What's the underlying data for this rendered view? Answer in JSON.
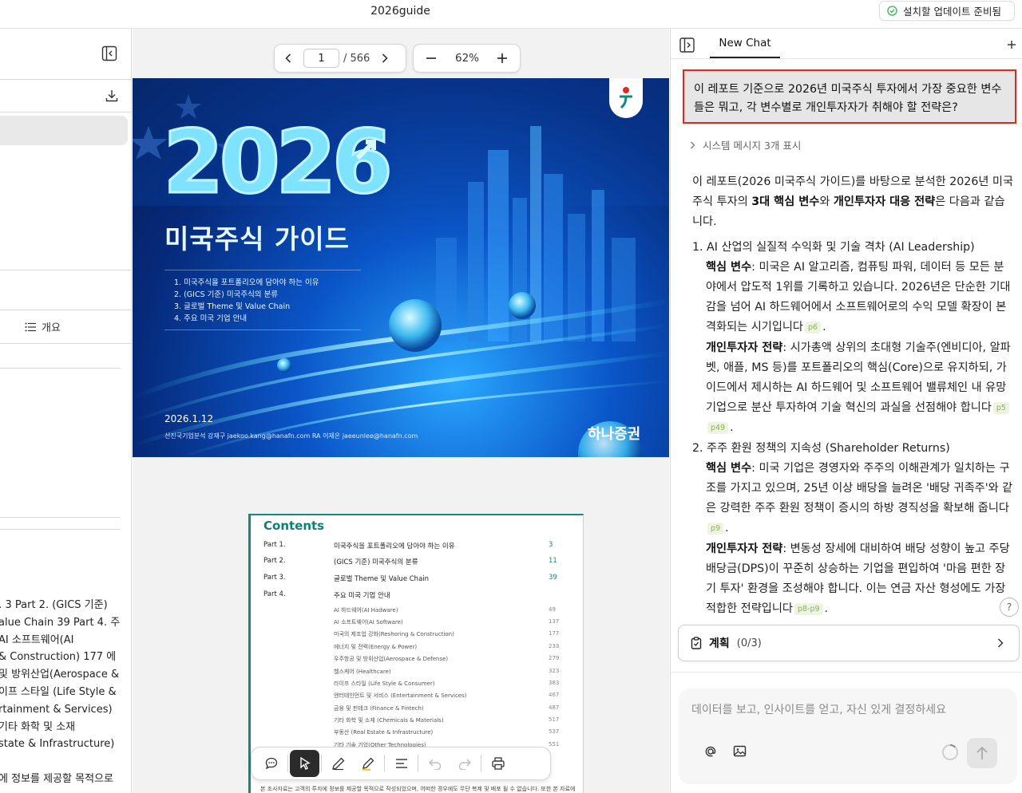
{
  "window": {
    "title": "2026guide",
    "update_status": "설치할 업데이트 준비됨"
  },
  "left_panel": {
    "outline_label": "개요",
    "text_lines": [
      "․ 3 Part 2. (GICS 기준)",
      "alue Chain 39 Part 4. 주",
      "AI 소프트웨어(AI",
      "& Construction) 177 에",
      "및 방위산업(Aerospace &",
      "이프 스타일 (Life Style &",
      "rtainment & Services)",
      "기타 화학 및 소재",
      "state & Infrastructure)",
      "",
      "에 정보를 제공할 목적으로"
    ]
  },
  "viewer": {
    "current_page": "1",
    "total_pages": "/ 566",
    "zoom": "62%",
    "cover": {
      "year": "2026",
      "title": "미국주식 가이드",
      "toc": [
        "1. 미국주식을 포트폴리오에 담아야 하는 이유",
        "2. (GICS 기준) 미국주식의 분류",
        "3. 글로벌 Theme 및 Value Chain",
        "4. 주요 미국 기업 안내"
      ],
      "date": "2026.1.12",
      "authors": "선진국기업분석 강재구 jaekoo.kang@hanafn.com        RA 이재은 jaeeunlee@hanafn.com",
      "brand": "하나증권"
    },
    "contents": {
      "title": "Contents",
      "parts": [
        {
          "label": "Part 1.",
          "title": "미국주식을 포트폴리오에 담아야 하는 이유",
          "page": "3"
        },
        {
          "label": "Part 2.",
          "title": "(GICS 기준) 미국주식의 분류",
          "page": "11"
        },
        {
          "label": "Part 3.",
          "title": "글로벌 Theme 및 Value Chain",
          "page": "39"
        },
        {
          "label": "Part 4.",
          "title": "주요 미국 기업 안내",
          "page": ""
        }
      ],
      "sub": [
        {
          "title": "AI 하드웨어(AI Hadware)",
          "page": "49"
        },
        {
          "title": "AI 소프트웨어(AI Software)",
          "page": "137"
        },
        {
          "title": "미국의 제조업 강화(Reshoring & Construction)",
          "page": "177"
        },
        {
          "title": "에너지 및 전력(Energy & Power)",
          "page": "233"
        },
        {
          "title": "우주항공 및 방위산업(Aerospace & Defense)",
          "page": "279"
        },
        {
          "title": "헬스케어 (Healthcare)",
          "page": "323"
        },
        {
          "title": "라이프 스타일 (Life Style & Consumer)",
          "page": "383"
        },
        {
          "title": "엔터테인먼트 및 서비스 (Entertainment & Services)",
          "page": "467"
        },
        {
          "title": "금융 및 핀테크 (Finance & Fintech)",
          "page": "487"
        },
        {
          "title": "기타 화학 및 소재 (Chemicals & Materials)",
          "page": "517"
        },
        {
          "title": "부동산 (Real Estate & Infrastructure)",
          "page": "537"
        },
        {
          "title": "기타 기술 기업(Other Technologies)",
          "page": "551"
        }
      ],
      "footer": "본 조사자료는 고객의 투자에 정보를 제공할 목적으로 작성되었으며, 어떠한 경우에도 무단 복제 및 배포 될 수 없습니다. 또한 본 자료에"
    }
  },
  "chat": {
    "tab": "New Chat",
    "user_question": "이 레포트 기준으로 2026년 미국주식 투자에서 가장 중요한 변수들은 뭐고, 각 변수별로 개인투자자가 취해야 할 전략은?",
    "system_toggle": "시스템 메시지 3개 표시",
    "intro_a": "이 레포트(2026 미국주식 가이드)를 바탕으로 분석한 2026년 미국 주식 투자의 ",
    "intro_b1": "3대 핵심 변수",
    "intro_c": "와 ",
    "intro_b2": "개인투자자 대응 전략",
    "intro_d": "은 다음과 같습니다.",
    "item1_title": "1. AI 산업의 실질적 수익화 및 기술 격차 (AI Leadership)",
    "key_label": "핵심 변수",
    "strategy_label": "개인투자자 전략",
    "item1_key": ": 미국은 AI 알고리즘, 컴퓨팅 파워, 데이터 등 모든 분야에서 압도적 1위를 기록하고 있습니다. 2026년은 단순한 기대감을 넘어 AI 하드웨어에서 소프트웨어로의 수익 모델 확장이 본격화되는 시기입니다",
    "item1_key_cite": "p6",
    "item1_strategy": ": 시가총액 상위의 초대형 기술주(엔비디아, 알파벳, 애플, MS 등)를 포트폴리오의 핵심(Core)으로 유지하되, 가이드에서 제시하는 AI 하드웨어 및 소프트웨어 밸류체인 내 유망 기업으로 분산 투자하여 기술 혁신의 과실을 선점해야 합니다",
    "item1_strategy_cites": [
      "p5",
      "p49"
    ],
    "item2_title": "2. 주주 환원 정책의 지속성 (Shareholder Returns)",
    "item2_key": ": 미국 기업은 경영자와 주주의 이해관계가 일치하는 구조를 가지고 있으며, 25년 이상 배당을 늘려온 '배당 귀족주'와 같은 강력한 주주 환원 정책이 증시의 하방 경직성을 확보해 줍니다",
    "item2_key_cite": "p9",
    "item2_strategy": ": 변동성 장세에 대비하여 배당 성향이 높고 주당 배당금(DPS)이 꾸준히 상승하는 기업을 편입하여 '마음 편한 장기 투자' 환경을 조성해야 합니다. 이는 연금 자산 형성에도 가장 적합한 전략입니다",
    "item2_strategy_cite": "p8-p9",
    "plan_label": "계획",
    "plan_count": "(0/3)",
    "input_placeholder": "데이터를 보고, 인사이트를 얻고, 자신 있게 결정하세요",
    "help": "?"
  },
  "colors": {
    "accent_red": "#e0281f",
    "teal": "#0f8a80",
    "citation_green": "#8bb158"
  }
}
